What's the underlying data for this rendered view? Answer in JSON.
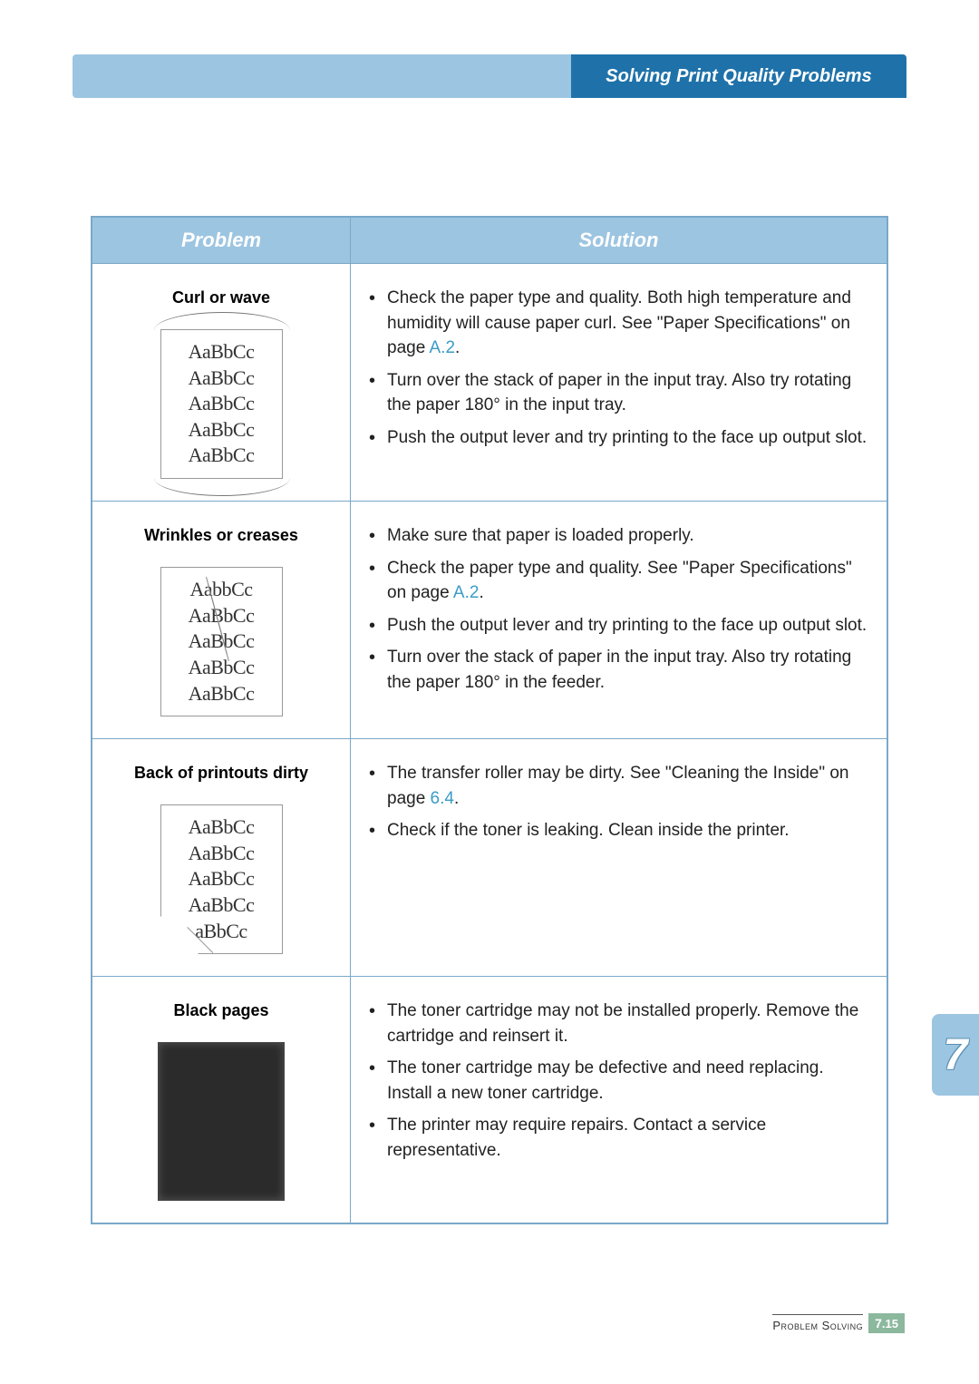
{
  "header": {
    "title": "Solving Print Quality Problems"
  },
  "table": {
    "col_problem": "Problem",
    "col_solution": "Solution",
    "rows": [
      {
        "problem": "Curl or wave",
        "sample_lines": [
          "AaBbCc",
          "AaBbCc",
          "AaBbCc",
          "AaBbCc",
          "AaBbCc"
        ],
        "bullets": [
          {
            "pre": "Check the paper type and quality. Both high temperature and humidity will cause paper curl. See \"Paper Specifications\" on page ",
            "link": "A.2",
            "post": "."
          },
          {
            "pre": "Turn over the stack of paper in the input tray. Also try rotating the paper 180° in the input tray."
          },
          {
            "pre": "Push the output lever and try printing to the face up output slot."
          }
        ]
      },
      {
        "problem": "Wrinkles or creases",
        "sample_lines": [
          "AabbCc",
          "AaBbCc",
          "AaBbCc",
          "AaBbCc",
          "AaBbCc"
        ],
        "bullets": [
          {
            "pre": "Make sure that paper is loaded properly."
          },
          {
            "pre": "Check the paper type and quality. See \"Paper Specifications\" on page ",
            "link": "A.2",
            "post": "."
          },
          {
            "pre": "Push the output lever and try printing to the face up output slot."
          },
          {
            "pre": "Turn over the stack of paper in the input tray. Also try rotating the paper 180° in the feeder."
          }
        ]
      },
      {
        "problem": "Back of printouts dirty",
        "sample_lines": [
          "AaBbCc",
          "AaBbCc",
          "AaBbCc",
          "AaBbCc",
          "aBbCc"
        ],
        "bullets": [
          {
            "pre": "The transfer roller may be dirty. See \"Cleaning the Inside\" on page ",
            "link": "6.4",
            "post": "."
          },
          {
            "pre": "Check if the toner is leaking. Clean inside the printer."
          }
        ]
      },
      {
        "problem": "Black pages",
        "sample_lines": [],
        "bullets": [
          {
            "pre": "The toner cartridge may not be installed properly. Remove the cartridge and reinsert it."
          },
          {
            "pre": "The toner cartridge may be defective and need replacing. Install a new toner cartridge."
          },
          {
            "pre": "The printer may require repairs. Contact a service representative."
          }
        ]
      }
    ]
  },
  "chapter": {
    "number": "7"
  },
  "footer": {
    "section": "Problem Solving",
    "page_chapter": "7",
    "page_number": ".15"
  }
}
